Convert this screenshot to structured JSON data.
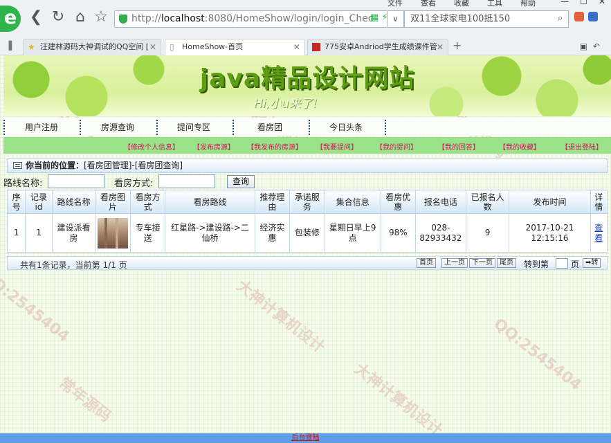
{
  "browser": {
    "menu": [
      "文件",
      "查看",
      "收藏",
      "工具",
      "帮助"
    ],
    "window_controls": [
      "—",
      "☐",
      "✕"
    ],
    "logo_letter": "e",
    "url_prefix": "http://",
    "url_host": "localhost",
    "url_rest": ":8080/HomeShow/login/login_Chec",
    "search_text": "双11全球家电100抵150",
    "tabs": [
      {
        "title": "汪建林源码大神调试的QQ空间 [",
        "active": false,
        "icon": "star-icon"
      },
      {
        "title": "HomeShow-首页",
        "active": true,
        "icon": "page-icon"
      },
      {
        "title": "775安卓Andriod学生成绩课件管",
        "active": false,
        "icon": "red-app-icon"
      }
    ]
  },
  "banner": {
    "title": "java精品设计网站",
    "subtitle": "Hi,小u来了!"
  },
  "nav": {
    "items": [
      "用户注册",
      "房源查询",
      "提问专区",
      "看房团",
      "今日头条"
    ]
  },
  "subnav": {
    "items": [
      "【修改个人信息】",
      "【发布房源】",
      "【我发布的房源】",
      "【我要提问】",
      "【我的提问】",
      "【我的回答】",
      "【我的收藏】",
      "【退出登陆】"
    ]
  },
  "location": {
    "label": "你当前的位置：",
    "path": "[看房团管理]-[看房团查询]"
  },
  "search_form": {
    "route_label": "路线名称:",
    "mode_label": "看房方式:",
    "route_value": "",
    "mode_value": "",
    "submit_label": "查询"
  },
  "table": {
    "headers": [
      "序号",
      "记录id",
      "路线名称",
      "看房图片",
      "看房方式",
      "看房路线",
      "推荐理由",
      "承诺服务",
      "集合信息",
      "看房优惠",
      "报名电话",
      "已报名人数",
      "发布时间",
      "详情"
    ],
    "rows": [
      {
        "seq": "1",
        "id": "1",
        "route_name": "建设派看房",
        "image": "building-photo",
        "mode": "专车接送",
        "route": "红星路->建设路->二仙桥",
        "reason": "经济实惠",
        "service": "包装修",
        "meeting": "星期日早上9点",
        "discount": "98%",
        "phone": "028-82933432",
        "signed": "9",
        "published": "2017-10-21 12:15:16",
        "detail_link": "查看"
      }
    ]
  },
  "pager": {
    "info": "共有1条记录，当前第 1/1 页",
    "first": "首页",
    "prev": "上一页",
    "next": "下一页",
    "last": "尾页",
    "goto_label": "转到第",
    "goto_value": "",
    "page_unit": "页",
    "go": "➡转"
  },
  "watermark": {
    "lines": [
      "QQ:2545404",
      "大神计算机设计",
      "常年源码",
      "QQ:2545404",
      "大神计算机设计",
      "QQ:2545404",
      "常年源码",
      "大神计算机设计"
    ]
  },
  "footer": {
    "admin_login": "后台登陆"
  },
  "colors": {
    "subnav_bg": "#9ae38a",
    "subnav_text": "#d4145a",
    "table_border": "#c3d6e7",
    "footer_bg": "#5d9ee7"
  }
}
